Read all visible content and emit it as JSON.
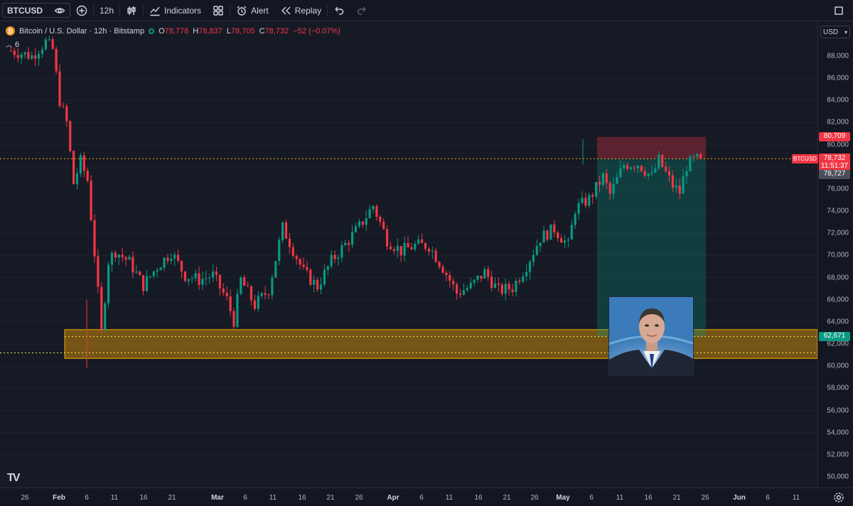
{
  "toolbar": {
    "symbol": "BTCUSD",
    "interval": "12h",
    "indicators_label": "Indicators",
    "alert_label": "Alert",
    "replay_label": "Replay"
  },
  "legend": {
    "title": "Bitcoin / U.S. Dollar · 12h · Bitstamp",
    "open_label": "O",
    "open": "78,778",
    "high_label": "H",
    "high": "78,837",
    "low_label": "L",
    "low": "78,705",
    "close_label": "C",
    "close": "78,732",
    "change": "−52 (−0.07%)",
    "collapsed_count": "6"
  },
  "price_axis": {
    "currency": "USD",
    "ticks": [
      "88,000",
      "86,000",
      "84,000",
      "82,000",
      "80,000",
      "78,000",
      "76,000",
      "74,000",
      "72,000",
      "70,000",
      "68,000",
      "66,000",
      "64,000",
      "62,000",
      "60,000",
      "58,000",
      "56,000",
      "54,000",
      "52,000",
      "50,000"
    ],
    "tags": {
      "stop": "80,709",
      "symbol_label": "BTCUSD",
      "last_price": "78,732",
      "countdown": "11:51:37",
      "crosshair": "78,727",
      "support": "62,671"
    }
  },
  "time_axis": {
    "ticks": [
      {
        "label": "26",
        "bold": false
      },
      {
        "label": "Feb",
        "bold": true
      },
      {
        "label": "6",
        "bold": false
      },
      {
        "label": "11",
        "bold": false
      },
      {
        "label": "16",
        "bold": false
      },
      {
        "label": "21",
        "bold": false
      },
      {
        "label": "Mar",
        "bold": true
      },
      {
        "label": "6",
        "bold": false
      },
      {
        "label": "11",
        "bold": false
      },
      {
        "label": "16",
        "bold": false
      },
      {
        "label": "21",
        "bold": false
      },
      {
        "label": "26",
        "bold": false
      },
      {
        "label": "Apr",
        "bold": true
      },
      {
        "label": "6",
        "bold": false
      },
      {
        "label": "11",
        "bold": false
      },
      {
        "label": "16",
        "bold": false
      },
      {
        "label": "21",
        "bold": false
      },
      {
        "label": "26",
        "bold": false
      },
      {
        "label": "May",
        "bold": true
      },
      {
        "label": "6",
        "bold": false
      },
      {
        "label": "11",
        "bold": false
      },
      {
        "label": "16",
        "bold": false
      },
      {
        "label": "21",
        "bold": false
      },
      {
        "label": "26",
        "bold": false
      },
      {
        "label": "Jun",
        "bold": true
      },
      {
        "label": "6",
        "bold": false
      },
      {
        "label": "11",
        "bold": false
      }
    ]
  },
  "colors": {
    "up": "#089981",
    "down": "#f23645",
    "support_zone": "#f7a600",
    "background": "#161a25",
    "accent": "#2962ff"
  },
  "chart_data": {
    "type": "candlestick",
    "symbol": "BTCUSD",
    "timeframe": "12h",
    "ylim": [
      49000,
      90500
    ],
    "current_price": 78732,
    "support_zone": [
      60700,
      63300
    ],
    "support_line": 62671,
    "dotted_low_line": 61200,
    "position": {
      "entry": 78732,
      "stop": 80709,
      "target": 62671
    },
    "path": [
      [
        "Jan 24",
        88500
      ],
      [
        "Jan 27",
        88000
      ],
      [
        "Jan 29",
        89300
      ],
      [
        "Jan 30",
        88600
      ],
      [
        "Jan 31",
        84000
      ],
      [
        "Feb 1",
        82000
      ],
      [
        "Feb 2",
        76500
      ],
      [
        "Feb 3",
        78500
      ],
      [
        "Feb 4",
        76800
      ],
      [
        "Feb 5",
        70200
      ],
      [
        "Feb 6",
        63000
      ],
      [
        "Feb 7",
        69500
      ],
      [
        "Feb 8",
        70400
      ],
      [
        "Feb 10",
        69400
      ],
      [
        "Feb 12",
        67300
      ],
      [
        "Feb 14",
        69000
      ],
      [
        "Feb 16",
        70300
      ],
      [
        "Feb 18",
        68200
      ],
      [
        "Feb 20",
        67800
      ],
      [
        "Feb 22",
        68200
      ],
      [
        "Feb 24",
        66000
      ],
      [
        "Feb 25",
        64100
      ],
      [
        "Feb 26",
        67800
      ],
      [
        "Feb 28",
        65500
      ],
      [
        "Mar 2",
        66900
      ],
      [
        "Mar 4",
        72500
      ],
      [
        "Mar 5",
        71200
      ],
      [
        "Mar 7",
        68500
      ],
      [
        "Mar 9",
        67200
      ],
      [
        "Mar 11",
        69500
      ],
      [
        "Mar 13",
        71000
      ],
      [
        "Mar 15",
        72600
      ],
      [
        "Mar 17",
        74500
      ],
      [
        "Mar 19",
        71400
      ],
      [
        "Mar 21",
        70400
      ],
      [
        "Mar 23",
        70900
      ],
      [
        "Mar 25",
        70900
      ],
      [
        "Mar 27",
        68900
      ],
      [
        "Mar 29",
        66600
      ],
      [
        "Mar 31",
        67200
      ],
      [
        "Apr 2",
        68500
      ],
      [
        "Apr 4",
        66800
      ],
      [
        "Apr 6",
        67100
      ],
      [
        "Apr 8",
        69100
      ],
      [
        "Apr 10",
        71600
      ],
      [
        "Apr 12",
        72400
      ],
      [
        "Apr 14",
        70900
      ],
      [
        "Apr 15",
        74200
      ],
      [
        "Apr 17",
        75100
      ],
      [
        "Apr 19",
        77100
      ],
      [
        "Apr 20",
        75500
      ],
      [
        "Apr 22",
        78200
      ],
      [
        "Apr 24",
        78300
      ],
      [
        "Apr 26",
        77100
      ],
      [
        "Apr 27",
        78600
      ],
      [
        "Apr 29",
        76300
      ],
      [
        "Apr 30",
        75700
      ],
      [
        "May 1",
        78100
      ],
      [
        "May 2",
        78600
      ],
      [
        "May 3",
        78732
      ]
    ]
  }
}
